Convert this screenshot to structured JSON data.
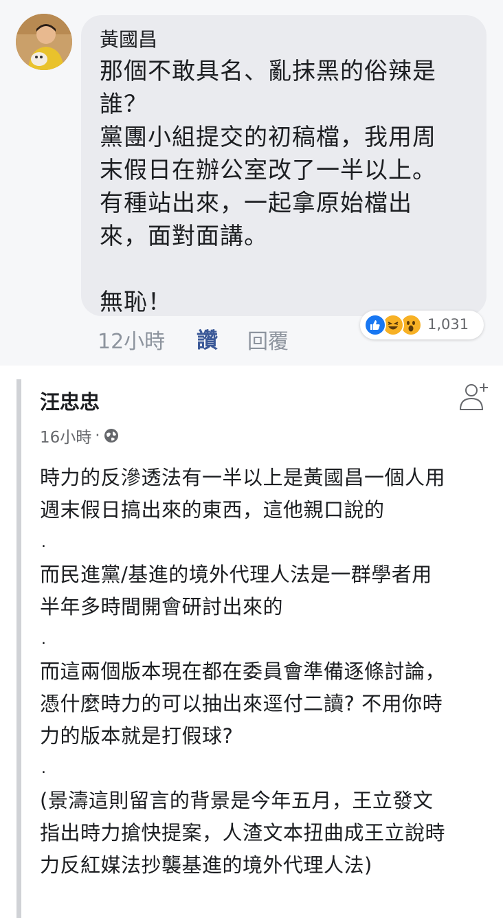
{
  "comment": {
    "author": "黃國昌",
    "text": "那個不敢具名、亂抹黑的俗辣是\n誰？\n黨團小組提交的初稿檔，我用周\n末假日在辦公室改了一半以上。\n有種站出來，一起拿原始檔出\n來，面對面講。\n\n無恥！",
    "time": "12小時",
    "like_label": "讚",
    "reply_label": "回覆",
    "reaction_count": "1,031",
    "reaction_icons": [
      "like-icon",
      "haha-icon",
      "wow-icon"
    ],
    "colors": {
      "like": "#3b5998",
      "bubble": "#eaebef"
    }
  },
  "post": {
    "author": "汪忠忠",
    "time": "16小時",
    "meta_separator": "·",
    "privacy_icon": "globe-icon",
    "follow_icon": "add-friend-icon",
    "lines": [
      "時力的反滲透法有一半以上是黃國昌一個人用",
      "週末假日搞出來的東西，這他親口說的",
      ".",
      "而民進黨/基進的境外代理人法是一群學者用",
      "半年多時間開會研討出來的",
      ".",
      "而這兩個版本現在都在委員會準備逐條討論，",
      "憑什麼時力的可以抽出來逕付二讀? 不用你時",
      "力的版本就是打假球?",
      ".",
      "(景濤這則留言的背景是今年五月，王立發文",
      "指出時力搶快提案，人渣文本扭曲成王立說時",
      "力反紅媒法抄襲基進的境外代理人法)"
    ]
  }
}
